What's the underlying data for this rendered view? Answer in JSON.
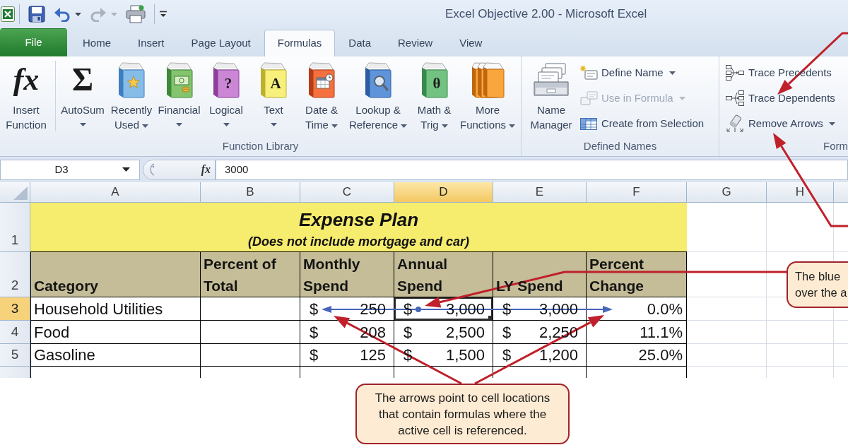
{
  "quick_access": [
    {
      "kind": "save",
      "disabled": false,
      "dropdown": false
    },
    {
      "kind": "undo",
      "disabled": false,
      "dropdown": true
    },
    {
      "kind": "redo",
      "disabled": true,
      "dropdown": true
    },
    {
      "kind": "print",
      "disabled": false,
      "dropdown": false
    }
  ],
  "window": {
    "title": "Excel Objective 2.00 - Microsoft Excel"
  },
  "tabs": [
    {
      "label": "File",
      "kind": "file",
      "selected": false
    },
    {
      "label": "Home",
      "kind": "tab",
      "selected": false
    },
    {
      "label": "Insert",
      "kind": "tab",
      "selected": false
    },
    {
      "label": "Page Layout",
      "kind": "tab",
      "selected": false
    },
    {
      "label": "Formulas",
      "kind": "tab",
      "selected": true
    },
    {
      "label": "Data",
      "kind": "tab",
      "selected": false
    },
    {
      "label": "Review",
      "kind": "tab",
      "selected": false
    },
    {
      "label": "View",
      "kind": "tab",
      "selected": false
    }
  ],
  "ribbon": {
    "groups": [
      {
        "label": "Function Library",
        "large_buttons": [
          {
            "kind": "fx",
            "glyph": "fx",
            "label": "Insert\nFunction",
            "dropdown": false
          },
          {
            "kind": "sum",
            "glyph": "Σ",
            "label": "AutoSum",
            "dropdown": true
          },
          {
            "kind": "recent",
            "label": "Recently\nUsed",
            "dropdown": true
          },
          {
            "kind": "financial",
            "label": "Financial",
            "dropdown": true
          },
          {
            "kind": "logical",
            "glyph": "?",
            "label": "Logical",
            "dropdown": true
          },
          {
            "kind": "text",
            "glyph": "A",
            "label": "Text",
            "dropdown": true
          },
          {
            "kind": "datetime",
            "label": "Date &\nTime",
            "dropdown": true
          },
          {
            "kind": "lookup",
            "label": "Lookup &\nReference",
            "dropdown": true
          },
          {
            "kind": "math",
            "glyph": "θ",
            "label": "Math &\nTrig",
            "dropdown": true
          },
          {
            "kind": "more",
            "label": "More\nFunctions",
            "dropdown": true
          }
        ]
      },
      {
        "label": "Defined Names",
        "large_buttons": [
          {
            "kind": "names",
            "label": "Name\nManager",
            "dropdown": false
          }
        ],
        "small_buttons": [
          {
            "kind": "define",
            "label": "Define Name",
            "dropdown": true,
            "disabled": false
          },
          {
            "kind": "use",
            "label": "Use in Formula",
            "dropdown": true,
            "disabled": true
          },
          {
            "kind": "create",
            "label": "Create from Selection",
            "dropdown": false,
            "disabled": false
          }
        ]
      },
      {
        "label": "Form",
        "small_buttons": [
          {
            "kind": "precedents",
            "label": "Trace Precedents",
            "dropdown": false,
            "disabled": false
          },
          {
            "kind": "dependents",
            "label": "Trace Dependents",
            "dropdown": false,
            "disabled": false
          },
          {
            "kind": "remove",
            "label": "Remove Arrows",
            "dropdown": true,
            "disabled": false
          }
        ]
      }
    ]
  },
  "formula_bar": {
    "name_box": "D3",
    "function_button": "fx",
    "value": "3000"
  },
  "sheet": {
    "columns": [
      {
        "label": "A",
        "selected": false
      },
      {
        "label": "B",
        "selected": false
      },
      {
        "label": "C",
        "selected": false
      },
      {
        "label": "D",
        "selected": true
      },
      {
        "label": "E",
        "selected": false
      },
      {
        "label": "F",
        "selected": false
      },
      {
        "label": "G",
        "selected": false
      },
      {
        "label": "H",
        "selected": false
      }
    ],
    "rows": [
      {
        "label": "1",
        "kind": "title",
        "selected": false,
        "title": "Expense Plan",
        "subtitle": "(Does not include mortgage and car)"
      },
      {
        "label": "2",
        "kind": "header",
        "selected": false,
        "cells": [
          "Category",
          "Percent of\nTotal",
          "Monthly\nSpend",
          "Annual\nSpend",
          "LY Spend",
          "Percent\nChange"
        ]
      },
      {
        "label": "3",
        "kind": "data",
        "selected": true,
        "category": "Household Utilities",
        "monthly_spend": {
          "symbol": "$",
          "amount": "250"
        },
        "annual_spend": {
          "symbol": "$",
          "amount": "3,000"
        },
        "ly_spend": {
          "symbol": "$",
          "amount": "3,000"
        },
        "percent_change": "0.0%"
      },
      {
        "label": "4",
        "kind": "data",
        "selected": false,
        "category": "Food",
        "monthly_spend": {
          "symbol": "$",
          "amount": "208"
        },
        "annual_spend": {
          "symbol": "$",
          "amount": "2,500"
        },
        "ly_spend": {
          "symbol": "$",
          "amount": "2,250"
        },
        "percent_change": "11.1%"
      },
      {
        "label": "5",
        "kind": "data",
        "selected": false,
        "category": "Gasoline",
        "monthly_spend": {
          "symbol": "$",
          "amount": "125"
        },
        "annual_spend": {
          "symbol": "$",
          "amount": "1,500"
        },
        "ly_spend": {
          "symbol": "$",
          "amount": "1,200"
        },
        "percent_change": "25.0%"
      }
    ]
  },
  "callouts": [
    {
      "text": "The blue\nover the a"
    },
    {
      "text": "The arrows point to cell locations that contain formulas where the active cell is referenced."
    }
  ]
}
